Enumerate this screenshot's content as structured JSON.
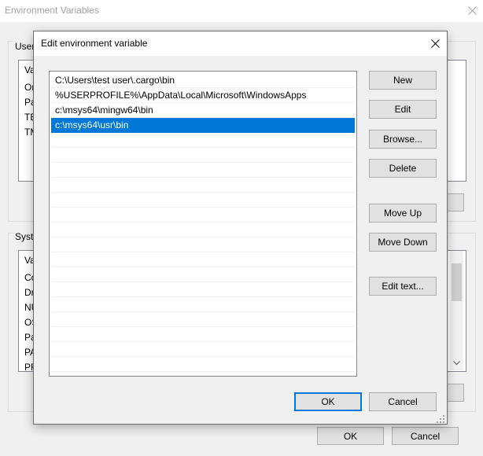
{
  "parent_window": {
    "title": "Environment Variables",
    "user_group_label": "User",
    "user_vars_rows": [
      "Va",
      "On",
      "Pa",
      "TE",
      "TM"
    ],
    "system_group_label": "Syste",
    "system_vars_rows": [
      "Va",
      "Co",
      "Dr",
      "NU",
      "OS",
      "Pa",
      "PA",
      "PR"
    ],
    "ok_label": "OK",
    "cancel_label": "Cancel"
  },
  "dialog": {
    "title": "Edit environment variable",
    "paths": [
      "C:\\Users\\test user\\.cargo\\bin",
      "%USERPROFILE%\\AppData\\Local\\Microsoft\\WindowsApps",
      "c:\\msys64\\mingw64\\bin",
      "c:\\msys64\\usr\\bin"
    ],
    "selected_path": "c:\\msys64\\usr\\bin",
    "buttons": {
      "new": "New",
      "edit": "Edit",
      "browse": "Browse...",
      "delete": "Delete",
      "move_up": "Move Up",
      "move_down": "Move Down",
      "edit_text": "Edit text..."
    },
    "ok_label": "OK",
    "cancel_label": "Cancel"
  },
  "colors": {
    "selection": "#0078d7",
    "default_button_border": "#0078d7",
    "background": "#f0f0f0"
  },
  "icons": [
    "close-icon",
    "chevron-down-icon",
    "resize-grip-icon"
  ]
}
